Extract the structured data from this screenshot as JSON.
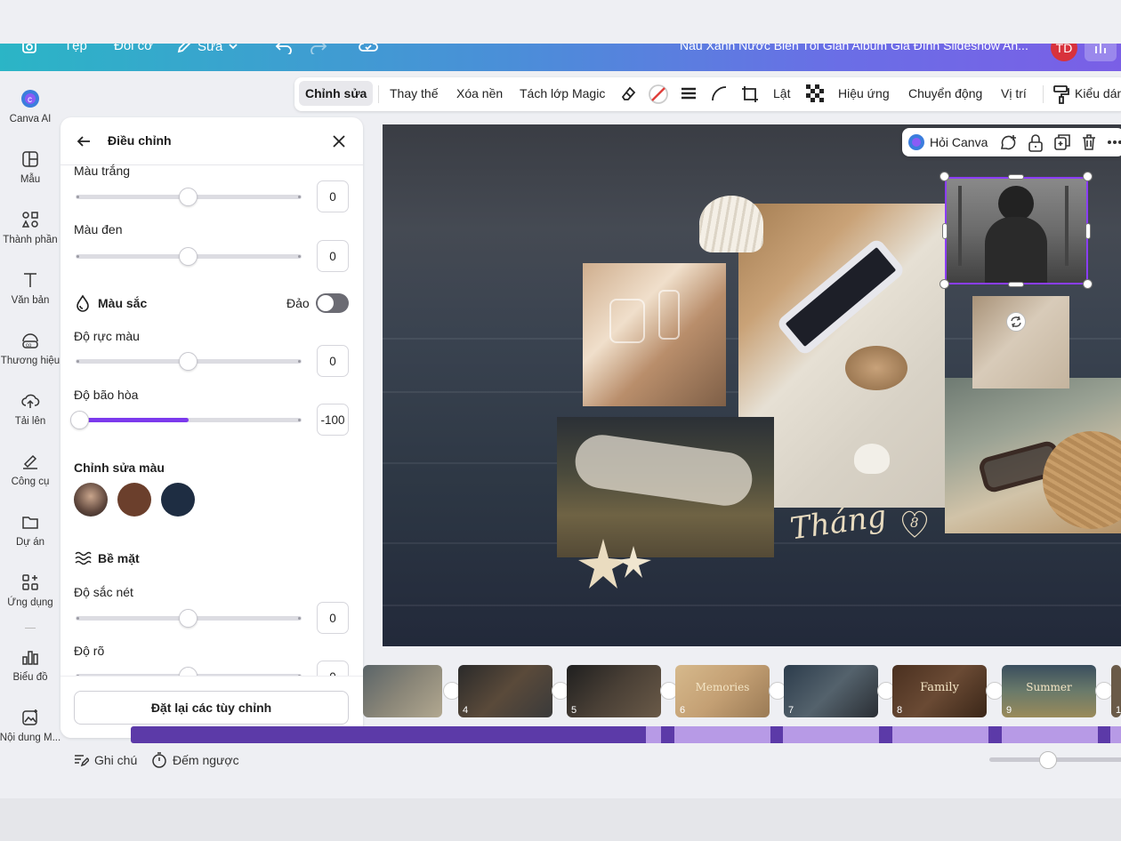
{
  "topbar": {
    "file": "Tệp",
    "resize": "Đổi cỡ",
    "edit": "Sửa",
    "doc_title": "Nâu Xanh Nước Biển Tối Giản Album Gia Đình Slideshow An...",
    "avatar": "TD"
  },
  "rail": {
    "items": [
      "Canva AI",
      "Mẫu",
      "Thành phần",
      "Văn bản",
      "Thương hiệu",
      "Tải lên",
      "Công cụ",
      "Dự án",
      "Ứng dụng",
      "Biểu đồ",
      "Nội dung M..."
    ]
  },
  "panel": {
    "title": "Điều chỉnh",
    "white_label": "Màu trắng",
    "white_value": "0",
    "white_level": 0,
    "black_label": "Màu đen",
    "black_value": "0",
    "black_level": 0,
    "color_section": "Màu sắc",
    "invert_label": "Đảo",
    "invert_on": false,
    "vibrance_label": "Độ rực màu",
    "vibrance_value": "0",
    "vibrance_level": 0,
    "saturation_label": "Độ bão hòa",
    "saturation_value": "-100",
    "saturation_level": -100,
    "edit_colors_label": "Chỉnh sửa màu",
    "swatch_colors": [
      "#7a5a4c",
      "#6b3f2c",
      "#1e2d42"
    ],
    "surface_section": "Bề mặt",
    "sharpness_label": "Độ sắc nét",
    "sharpness_value": "0",
    "sharpness_level": 0,
    "clarity_label": "Độ rõ",
    "clarity_value": "0",
    "reset_button": "Đặt lại các tùy chỉnh"
  },
  "toolbar": {
    "edit": "Chỉnh sửa",
    "replace": "Thay thế",
    "remove_bg": "Xóa nền",
    "magic_layer": "Tách lớp Magic",
    "flip": "Lật",
    "effects": "Hiệu ứng",
    "animate": "Chuyển động",
    "position": "Vị trí",
    "style": "Kiểu dán"
  },
  "canvas": {
    "ask_canva": "Hỏi Canva",
    "script_text": "Tháng",
    "heart_number": "8"
  },
  "timeline": {
    "pages": [
      {
        "num": "",
        "caption": ""
      },
      {
        "num": "4",
        "caption": ""
      },
      {
        "num": "5",
        "caption": ""
      },
      {
        "num": "6",
        "caption": "Memories"
      },
      {
        "num": "7",
        "caption": ""
      },
      {
        "num": "8",
        "caption": "Family"
      },
      {
        "num": "9",
        "caption": "Summer"
      },
      {
        "num": "1",
        "caption": ""
      }
    ],
    "notes": "Ghi chú",
    "timer": "Đếm ngược"
  },
  "colors": {
    "accent": "#7c3aed",
    "selection": "#8b3dff"
  }
}
